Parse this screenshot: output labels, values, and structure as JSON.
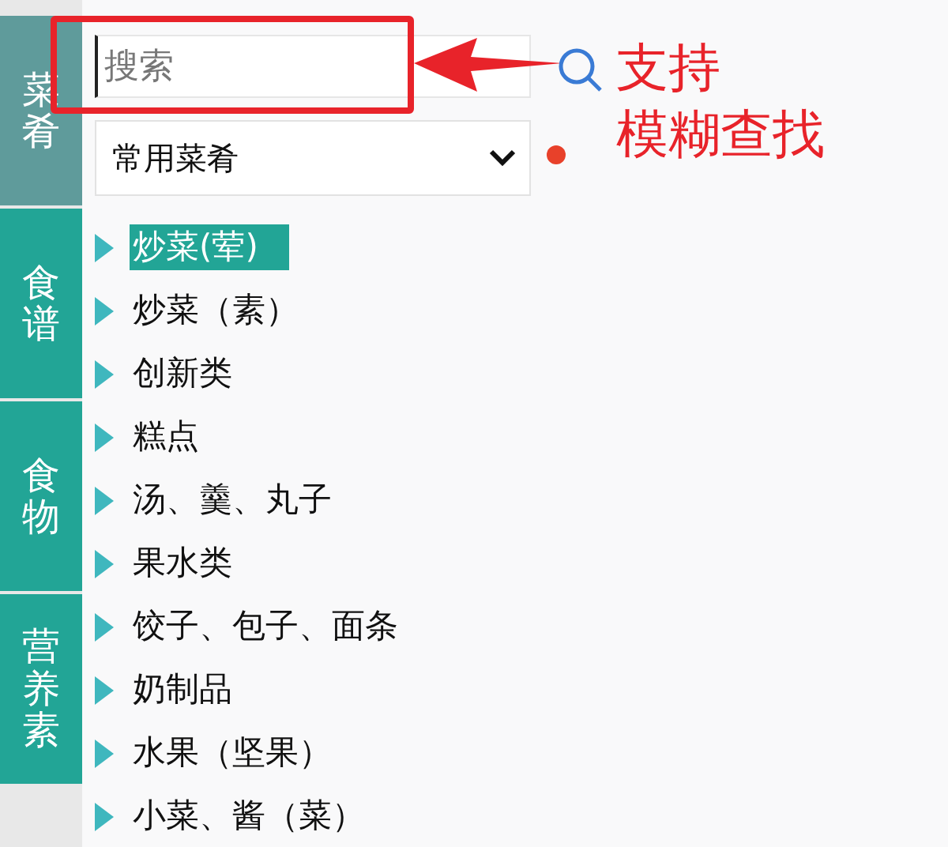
{
  "sidebar": {
    "tabs": [
      {
        "label": "菜肴",
        "selected": true
      },
      {
        "label": "食谱",
        "selected": false
      },
      {
        "label": "食物",
        "selected": false
      },
      {
        "label": "营养素",
        "selected": false
      }
    ]
  },
  "search": {
    "placeholder": "搜索"
  },
  "dropdown": {
    "value": "常用菜肴"
  },
  "tree": {
    "items": [
      {
        "label": "炒菜(荤)",
        "selected": true,
        "expanded": false
      },
      {
        "label": "炒菜（素）",
        "selected": false,
        "expanded": false
      },
      {
        "label": "创新类",
        "selected": false,
        "expanded": false
      },
      {
        "label": "糕点",
        "selected": false,
        "expanded": false
      },
      {
        "label": "汤、羹、丸子",
        "selected": false,
        "expanded": false
      },
      {
        "label": "果水类",
        "selected": false,
        "expanded": false
      },
      {
        "label": "饺子、包子、面条",
        "selected": false,
        "expanded": false
      },
      {
        "label": "奶制品",
        "selected": false,
        "expanded": false
      },
      {
        "label": "水果（坚果）",
        "selected": false,
        "expanded": false
      },
      {
        "label": "小菜、酱（菜）",
        "selected": false,
        "expanded": false
      }
    ]
  },
  "annotation": {
    "lines": [
      "支持",
      "模糊查找"
    ]
  }
}
